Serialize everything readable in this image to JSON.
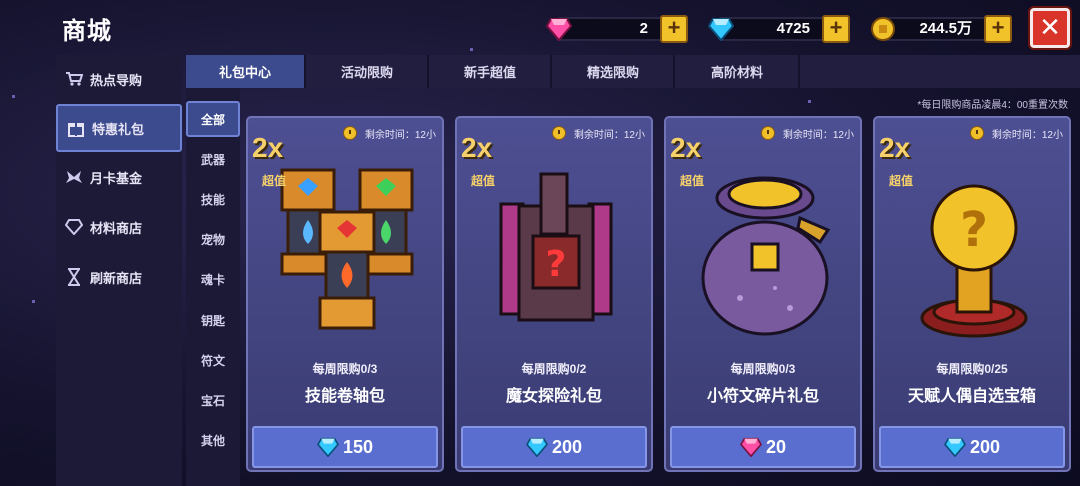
{
  "header": {
    "title": "商城",
    "close_label": "✕"
  },
  "currencies": [
    {
      "name": "pink-gem",
      "value": "2",
      "color": "#ff4fa6"
    },
    {
      "name": "blue-gem",
      "value": "4725",
      "color": "#33c8ff"
    },
    {
      "name": "gold-coin",
      "value": "244.5万",
      "color": "#f2c22a"
    }
  ],
  "sidebar": {
    "items": [
      {
        "label": "热点导购",
        "icon": "cart-icon"
      },
      {
        "label": "特惠礼包",
        "icon": "gift-icon"
      },
      {
        "label": "月卡基金",
        "icon": "wings-icon"
      },
      {
        "label": "材料商店",
        "icon": "gem-stack-icon"
      },
      {
        "label": "刷新商店",
        "icon": "hourglass-icon"
      }
    ],
    "active_index": 1
  },
  "tabs": {
    "items": [
      "礼包中心",
      "活动限购",
      "新手超值",
      "精选限购",
      "高阶材料"
    ],
    "active_index": 0
  },
  "subcategories": {
    "items": [
      "全部",
      "武器",
      "技能",
      "宠物",
      "魂卡",
      "钥匙",
      "符文",
      "宝石",
      "其他"
    ],
    "active_index": 0
  },
  "note": "*每日限购商品凌晨4：00重置次数",
  "cards": [
    {
      "multiplier": "2x",
      "tag": "超值",
      "timer": "剩余时间：12小",
      "limit": "每周限购0/3",
      "name": "技能卷轴包",
      "price": "150",
      "currency": "blue-gem"
    },
    {
      "multiplier": "2x",
      "tag": "超值",
      "timer": "剩余时间：12小",
      "limit": "每周限购0/2",
      "name": "魔女探险礼包",
      "price": "200",
      "currency": "blue-gem"
    },
    {
      "multiplier": "2x",
      "tag": "超值",
      "timer": "剩余时间：12小",
      "limit": "每周限购0/3",
      "name": "小符文碎片礼包",
      "price": "20",
      "currency": "pink-gem"
    },
    {
      "multiplier": "2x",
      "tag": "超值",
      "timer": "剩余时间：12小",
      "limit": "每周限购0/25",
      "name": "天赋人偶自选宝箱",
      "price": "200",
      "currency": "blue-gem"
    }
  ]
}
